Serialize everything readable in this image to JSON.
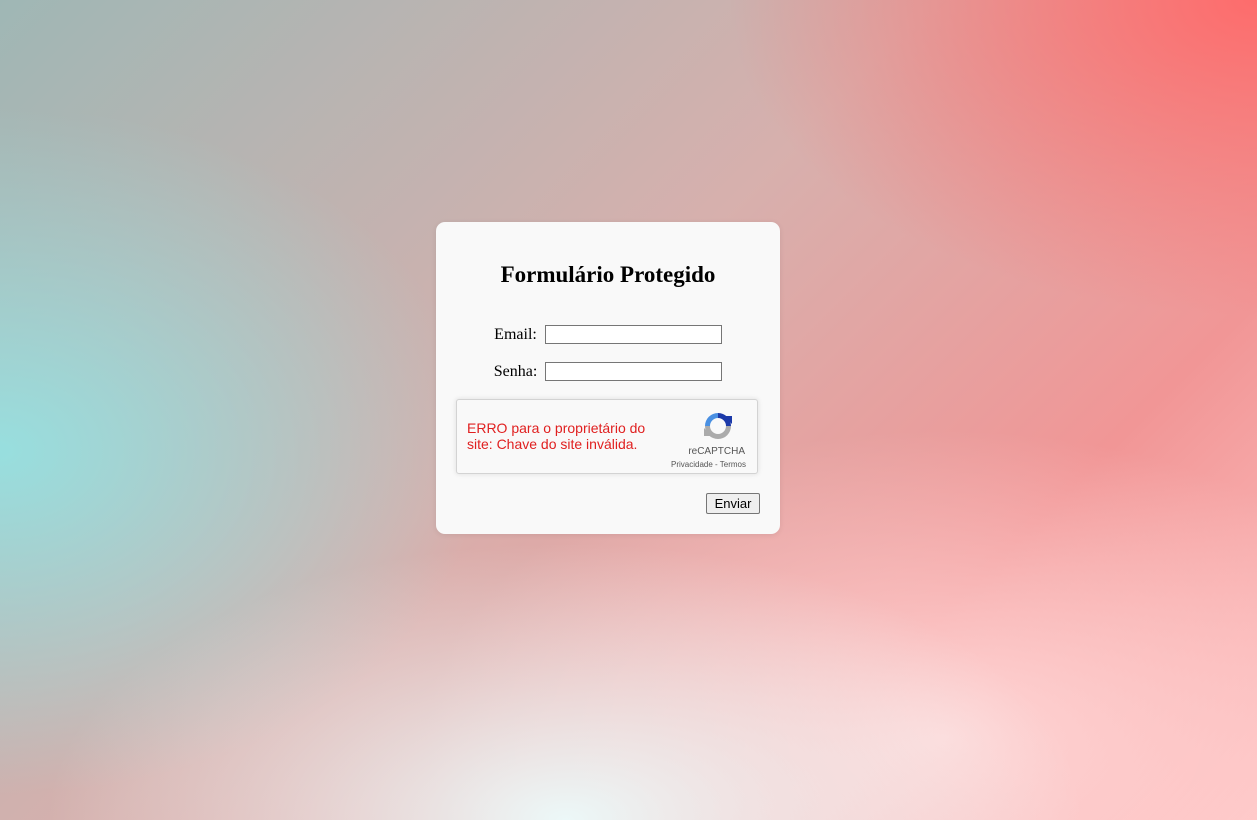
{
  "form": {
    "title": "Formulário Protegido",
    "email_label": "Email:",
    "email_value": "",
    "password_label": "Senha:",
    "password_value": "",
    "submit_label": "Enviar"
  },
  "captcha": {
    "error_message": "ERRO para o proprietário do site: Chave do site inválida.",
    "brand": "reCAPTCHA",
    "privacy_link": "Privacidade",
    "separator": " - ",
    "terms_link": "Termos",
    "logo_icon": "recaptcha-logo-icon",
    "error_color": "#e02020"
  },
  "colors": {
    "card_background": "#f9f9f9",
    "gradient_top_right": "#ff6969",
    "gradient_left": "#96e1e1"
  }
}
